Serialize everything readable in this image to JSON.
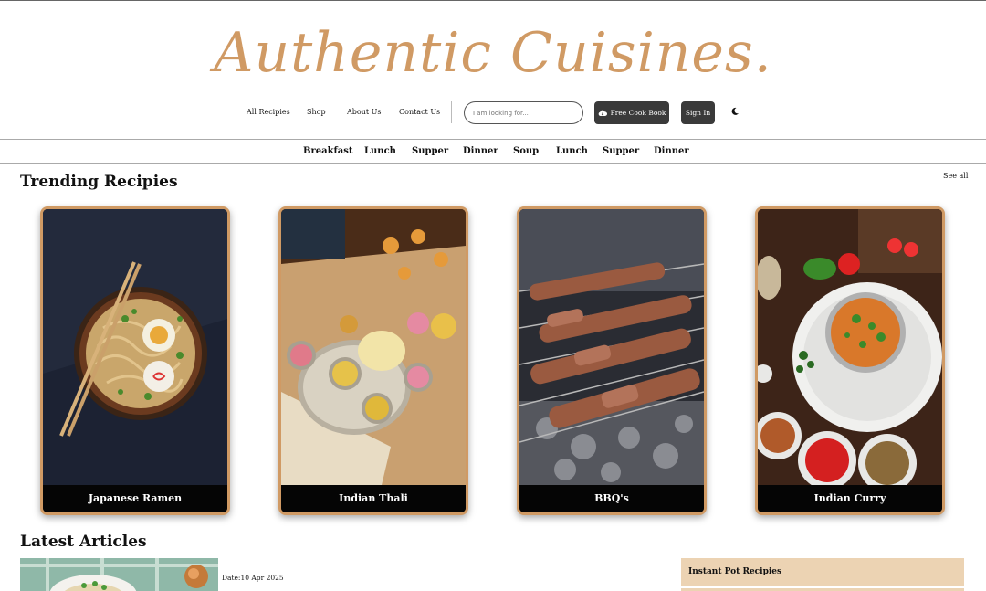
{
  "brand": {
    "logo_text": "Authentic Cuisines.",
    "accent_color": "#d09a64"
  },
  "nav": {
    "links": [
      "All Recipies",
      "Shop",
      "About Us",
      "Contact Us"
    ],
    "search_placeholder": "I am looking for...",
    "free_cook_book_label": "Free Cook Book",
    "free_cook_book_icon": "cloud-download-icon",
    "sign_in_label": "Sign In",
    "theme_toggle_icon": "moon-icon"
  },
  "categories": [
    "Breakfast",
    "Lunch",
    "Supper",
    "Dinner",
    "Soup",
    "Lunch",
    "Supper",
    "Dinner"
  ],
  "trending": {
    "title": "Trending Recipies",
    "see_all": "See all",
    "cards": [
      {
        "name": "Japanese Ramen",
        "image": "ramen-bowl-image"
      },
      {
        "name": "Indian Thali",
        "image": "thali-platter-image"
      },
      {
        "name": "BBQ's",
        "image": "bbq-skewers-image"
      },
      {
        "name": "Indian Curry",
        "image": "curry-bowl-image"
      }
    ]
  },
  "latest": {
    "title": "Latest Articles",
    "first_article_date": "Date:10 Apr 2025",
    "sidebar_box_title": "Instant Pot Recipies"
  }
}
